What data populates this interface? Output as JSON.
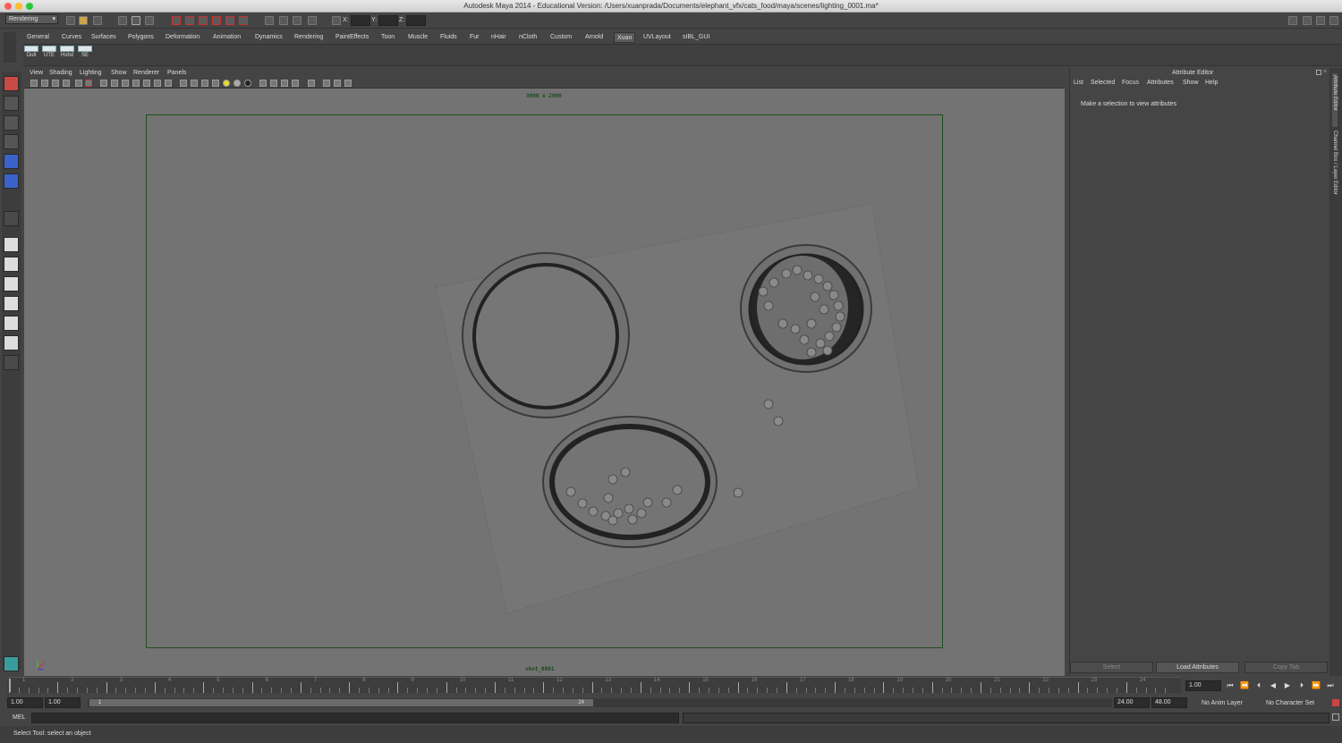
{
  "window": {
    "title": "Autodesk Maya 2014 - Educational Version: /Users/xuanprada/Documents/elephant_vfx/cats_food/maya/scenes/lighting_0001.ma*"
  },
  "status_line": {
    "menu_set": "Rendering",
    "x_label": "X:",
    "y_label": "Y:",
    "z_label": "Z:"
  },
  "shelf_tabs": [
    "General",
    "Curves",
    "Surfaces",
    "Polygons",
    "Deformation",
    "Animation",
    "Dynamics",
    "Rendering",
    "PaintEffects",
    "Toon",
    "Muscle",
    "Fluids",
    "Fur",
    "nHair",
    "nCloth",
    "Custom",
    "Arnold",
    "Xuan",
    "UVLayout",
    "sIBL_GUI"
  ],
  "active_shelf_tab": "Xuan",
  "shelf_buttons": [
    "Outl",
    "UTE",
    "Hshd",
    "SE"
  ],
  "viewport": {
    "menu": [
      "View",
      "Shading",
      "Lighting",
      "Show",
      "Renderer",
      "Panels"
    ],
    "resolution_label": "3000 x 2000",
    "camera_label": "shot_0001"
  },
  "attribute_editor": {
    "title": "Attribute Editor",
    "menu": [
      "List",
      "Selected",
      "Focus",
      "Attributes",
      "Show",
      "Help"
    ],
    "message": "Make a selection to view attributes",
    "buttons": [
      "Select",
      "Load Attributes",
      "Copy Tab"
    ]
  },
  "side_tabs": [
    "Attribute Editor",
    "Channel Box / Layer Editor"
  ],
  "time_slider": {
    "ticks": [
      "1",
      "2",
      "3",
      "4",
      "5",
      "6",
      "7",
      "8",
      "9",
      "10",
      "11",
      "12",
      "13",
      "14",
      "15",
      "16",
      "17",
      "18",
      "19",
      "20",
      "21",
      "22",
      "23",
      "24"
    ],
    "current_time": "1.00"
  },
  "range_slider": {
    "start_time": "1.00",
    "playback_start": "1.00",
    "range_start_label": "1",
    "range_end_label": "24",
    "playback_end": "24.00",
    "end_time": "48.00",
    "anim_layer": "No Anim Layer",
    "character_set": "No Character Set"
  },
  "command_line": {
    "language": "MEL"
  },
  "help_line": {
    "text": "Select Tool: select an object"
  }
}
